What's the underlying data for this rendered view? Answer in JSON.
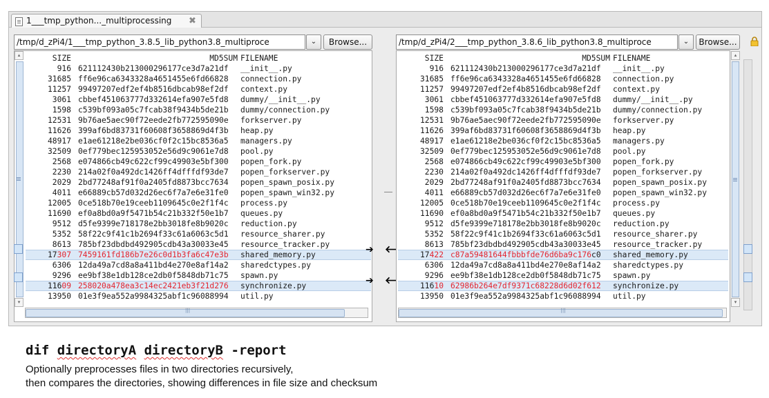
{
  "tab": {
    "title": "1___tmp_python..._multiprocessing",
    "close": "✖"
  },
  "left": {
    "path": "/tmp/d_zPi4/1___tmp_python_3.8.5_lib_python3.8_multiproce",
    "browse": "Browse...",
    "rows": [
      {
        "size": "SIZE",
        "md5": "MD5SUM",
        "name": "FILENAME"
      },
      {
        "size": "916",
        "md5": "621112430b213000296177ce3d7a21df",
        "name": "__init__.py"
      },
      {
        "size": "31685",
        "md5": "ff6e96ca6343328a4651455e6fd66828",
        "name": "connection.py"
      },
      {
        "size": "11257",
        "md5": "99497207edf2ef4b8516dbcab98ef2df",
        "name": "context.py"
      },
      {
        "size": "3061",
        "md5": "cbbef451063777d332614efa907e5fd8",
        "name": "dummy/__init__.py"
      },
      {
        "size": "1598",
        "md5": "c539bf093a05c7fcab38f9434b5de21b",
        "name": "dummy/connection.py"
      },
      {
        "size": "12531",
        "md5": "9b76ae5aec90f72eede2fb772595090e",
        "name": "forkserver.py"
      },
      {
        "size": "11626",
        "md5": "399af6bd83731f60608f3658869d4f3b",
        "name": "heap.py"
      },
      {
        "size": "48917",
        "md5": "e1ae61218e2be036cf0f2c15bc8536a5",
        "name": "managers.py"
      },
      {
        "size": "32509",
        "md5": "0ef779bec125953052e56d9c9061e7d8",
        "name": "pool.py"
      },
      {
        "size": "2568",
        "md5": "e074866cb49c622cf99c49903e5bf300",
        "name": "popen_fork.py"
      },
      {
        "size": "2230",
        "md5": "214a02f0a492dc1426ff4dfffdf93de7",
        "name": "popen_forkserver.py"
      },
      {
        "size": "2029",
        "md5": "2bd77248af91f0a2405fd8873bcc7634",
        "name": "popen_spawn_posix.py"
      },
      {
        "size": "4011",
        "md5": "e66889cb57d032d26ec6f7a7e6e31fe0",
        "name": "popen_spawn_win32.py"
      },
      {
        "size": "12005",
        "md5": "0ce518b70e19ceeb1109645c0e2f1f4c",
        "name": "process.py"
      },
      {
        "size": "11690",
        "md5": "ef0a8bd0a9f5471b54c21b332f50e1b7",
        "name": "queues.py"
      },
      {
        "size": "9512",
        "md5": "d5fe9399e718178e2bb3018fe8b9020c",
        "name": "reduction.py"
      },
      {
        "size": "5352",
        "md5": "58f22c9f41c1b2694f33c61a6063c5d1",
        "name": "resource_sharer.py"
      },
      {
        "size": "8613",
        "md5": "785bf23dbdbd492905cdb43a30033e45",
        "name": "resource_tracker.py"
      },
      {
        "size_pre": "17",
        "size_diff": "307",
        "md5_pre": "",
        "md5_diff": "7459161fd186b7e26c0d1b3fa6c47e3b",
        "md5_post": "",
        "name": "shared_memory.py",
        "diff": true
      },
      {
        "size": "6306",
        "md5": "12da49a7cd8a8a411bd4e270e8af14a2",
        "name": "sharedctypes.py"
      },
      {
        "size": "9296",
        "md5": "ee9bf38e1db128ce2db0f5848db71c75",
        "name": "spawn.py"
      },
      {
        "size_pre": "116",
        "size_diff": "09",
        "md5_pre": "",
        "md5_diff": "258020a478ea3c14ec2421eb3f21d276",
        "md5_post": "",
        "name": "synchronize.py",
        "diff": true
      },
      {
        "size": "13950",
        "md5": "01e3f9ea552a9984325abf1c96088994",
        "name": "util.py"
      }
    ]
  },
  "right": {
    "path": "/tmp/d_zPi4/2___tmp_python_3.8.6_lib_python3.8_multiproce",
    "browse": "Browse...",
    "rows": [
      {
        "size": "SIZE",
        "md5": "MD5SUM",
        "name": "FILENAME"
      },
      {
        "size": "916",
        "md5": "621112430b213000296177ce3d7a21df",
        "name": "__init__.py"
      },
      {
        "size": "31685",
        "md5": "ff6e96ca6343328a4651455e6fd66828",
        "name": "connection.py"
      },
      {
        "size": "11257",
        "md5": "99497207edf2ef4b8516dbcab98ef2df",
        "name": "context.py"
      },
      {
        "size": "3061",
        "md5": "cbbef451063777d332614efa907e5fd8",
        "name": "dummy/__init__.py"
      },
      {
        "size": "1598",
        "md5": "c539bf093a05c7fcab38f9434b5de21b",
        "name": "dummy/connection.py"
      },
      {
        "size": "12531",
        "md5": "9b76ae5aec90f72eede2fb772595090e",
        "name": "forkserver.py"
      },
      {
        "size": "11626",
        "md5": "399af6bd83731f60608f3658869d4f3b",
        "name": "heap.py"
      },
      {
        "size": "48917",
        "md5": "e1ae61218e2be036cf0f2c15bc8536a5",
        "name": "managers.py"
      },
      {
        "size": "32509",
        "md5": "0ef779bec125953052e56d9c9061e7d8",
        "name": "pool.py"
      },
      {
        "size": "2568",
        "md5": "e074866cb49c622cf99c49903e5bf300",
        "name": "popen_fork.py"
      },
      {
        "size": "2230",
        "md5": "214a02f0a492dc1426ff4dfffdf93de7",
        "name": "popen_forkserver.py"
      },
      {
        "size": "2029",
        "md5": "2bd77248af91f0a2405fd8873bcc7634",
        "name": "popen_spawn_posix.py"
      },
      {
        "size": "4011",
        "md5": "e66889cb57d032d26ec6f7a7e6e31fe0",
        "name": "popen_spawn_win32.py"
      },
      {
        "size": "12005",
        "md5": "0ce518b70e19ceeb1109645c0e2f1f4c",
        "name": "process.py"
      },
      {
        "size": "11690",
        "md5": "ef0a8bd0a9f5471b54c21b332f50e1b7",
        "name": "queues.py"
      },
      {
        "size": "9512",
        "md5": "d5fe9399e718178e2bb3018fe8b9020c",
        "name": "reduction.py"
      },
      {
        "size": "5352",
        "md5": "58f22c9f41c1b2694f33c61a6063c5d1",
        "name": "resource_sharer.py"
      },
      {
        "size": "8613",
        "md5": "785bf23dbdbd492905cdb43a30033e45",
        "name": "resource_tracker.py"
      },
      {
        "size_pre": "17",
        "size_diff": "422",
        "md5_pre": "",
        "md5_diff": "c87a59481644fbbbfde76d6ba9c176",
        "md5_post": "c0",
        "name": "shared_memory.py",
        "diff": true
      },
      {
        "size": "6306",
        "md5": "12da49a7cd8a8a411bd4e270e8af14a2",
        "name": "sharedctypes.py"
      },
      {
        "size": "9296",
        "md5": "ee9bf38e1db128ce2db0f5848db71c75",
        "name": "spawn.py"
      },
      {
        "size_pre": "116",
        "size_diff": "10",
        "md5_pre": "",
        "md5_diff": "62986b264e7df9371c68228d6d02f612",
        "md5_post": "",
        "name": "synchronize.py",
        "diff": true
      },
      {
        "size": "13950",
        "md5": "01e3f9ea552a9984325abf1c96088994",
        "name": "util.py"
      }
    ]
  },
  "arrows": {
    "copy_right": "➔",
    "copy_left": "🡐"
  },
  "caption": {
    "cmd_a": "dif ",
    "cmd_b": "directoryA",
    "cmd_c": " ",
    "cmd_d": "directoryB",
    "cmd_e": " -report",
    "line1": "Optionally preprocesses files in two directories recursively,",
    "line2": "then compares the directories, showing differences in file size and checksum"
  },
  "colors": {
    "diff_text": "#e32530",
    "diff_row_bg": "#dbe9f7",
    "gutter_blue": "#d8e6f5"
  }
}
